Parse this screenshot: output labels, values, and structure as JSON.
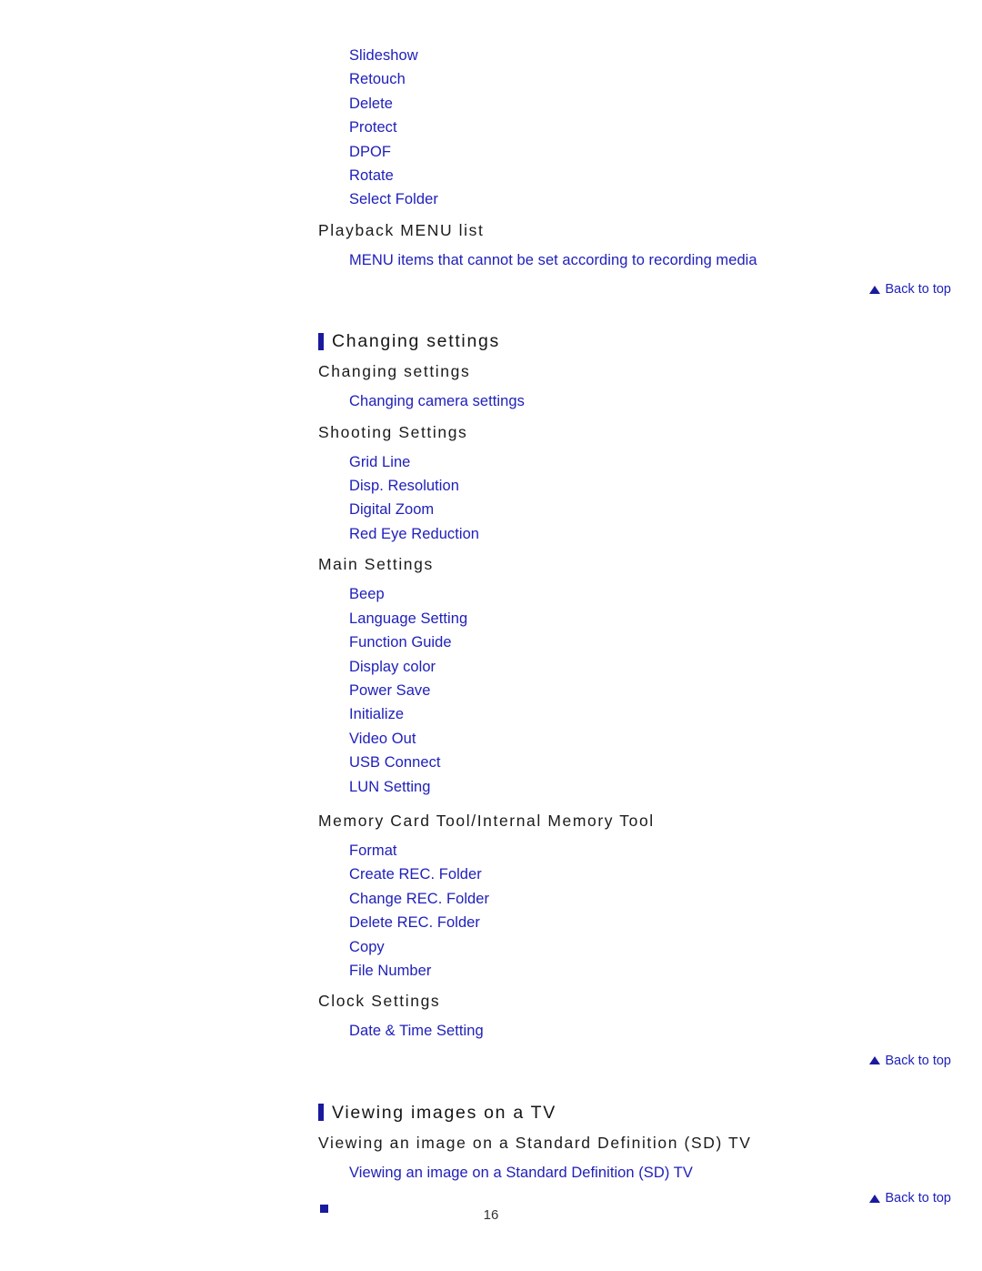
{
  "document": {
    "page_number": "16",
    "link_color": "#2020bb",
    "heading_color": "#161616",
    "accent_bar_color": "#1a1a9e",
    "back_to_top_label": "Back to top"
  },
  "playback_section": {
    "orphan_links": [
      "Slideshow",
      "Retouch",
      "Delete",
      "Protect",
      "DPOF",
      "Rotate",
      "Select Folder"
    ],
    "heading": "Playback MENU list",
    "links": [
      "MENU items that cannot be set according to recording media"
    ]
  },
  "changing_settings": {
    "section_title": "Changing settings",
    "groups": [
      {
        "heading": "Changing settings",
        "links": [
          "Changing camera settings"
        ]
      },
      {
        "heading": "Shooting Settings",
        "links": [
          "Grid Line",
          "Disp. Resolution",
          "Digital Zoom",
          "Red Eye Reduction"
        ]
      },
      {
        "heading": "Main Settings",
        "links": [
          "Beep",
          "Language Setting",
          "Function Guide",
          "Display color",
          "Power Save",
          "Initialize",
          "Video Out",
          "USB Connect",
          "LUN Setting"
        ]
      },
      {
        "heading": "Memory Card Tool/Internal Memory Tool",
        "links": [
          "Format",
          "Create REC. Folder",
          "Change REC. Folder",
          "Delete REC. Folder",
          "Copy",
          "File Number"
        ]
      },
      {
        "heading": "Clock Settings",
        "links": [
          "Date & Time Setting"
        ]
      }
    ]
  },
  "viewing_tv": {
    "section_title": "Viewing images on a TV",
    "groups": [
      {
        "heading": "Viewing an image on a Standard Definition (SD) TV",
        "links": [
          "Viewing an image on a Standard Definition (SD) TV"
        ]
      }
    ]
  }
}
